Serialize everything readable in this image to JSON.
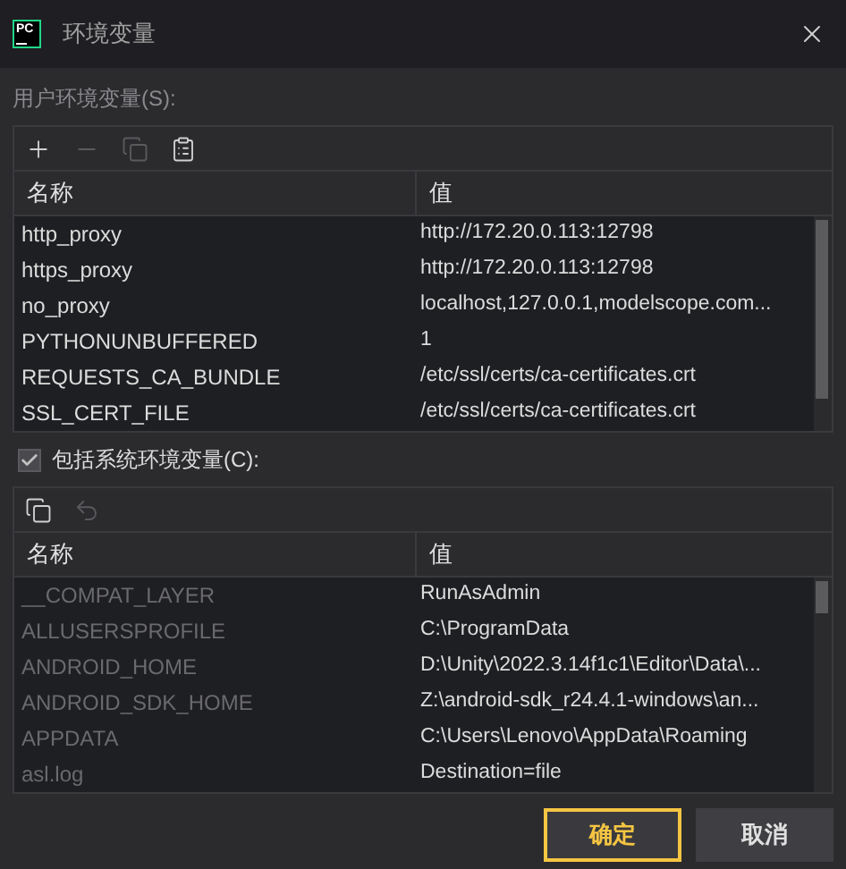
{
  "window": {
    "title": "环境变量",
    "logo_text": "PC"
  },
  "user_vars": {
    "label": "用户环境变量(S):",
    "toolbar": [
      {
        "kind": "add",
        "disabled": false
      },
      {
        "kind": "remove",
        "disabled": true
      },
      {
        "kind": "copy",
        "disabled": true
      },
      {
        "kind": "paste",
        "disabled": false
      }
    ],
    "columns": [
      "名称",
      "值"
    ],
    "rows": [
      {
        "name": "http_proxy",
        "value": "http://172.20.0.113:12798",
        "disabled": false
      },
      {
        "name": "https_proxy",
        "value": "http://172.20.0.113:12798",
        "disabled": false
      },
      {
        "name": "no_proxy",
        "value": "localhost,127.0.0.1,modelscope.com...",
        "disabled": false
      },
      {
        "name": "PYTHONUNBUFFERED",
        "value": "1",
        "disabled": false
      },
      {
        "name": "REQUESTS_CA_BUNDLE",
        "value": "/etc/ssl/certs/ca-certificates.crt",
        "disabled": false
      },
      {
        "name": "SSL_CERT_FILE",
        "value": "/etc/ssl/certs/ca-certificates.crt",
        "disabled": false
      }
    ]
  },
  "include_system": {
    "label": "包括系统环境变量(C):",
    "checked": true
  },
  "system_vars": {
    "toolbar": [
      {
        "kind": "copy",
        "disabled": false
      },
      {
        "kind": "undo",
        "disabled": true
      }
    ],
    "columns": [
      "名称",
      "值"
    ],
    "rows": [
      {
        "name": "__COMPAT_LAYER",
        "value": "RunAsAdmin",
        "disabled": true
      },
      {
        "name": "ALLUSERSPROFILE",
        "value": "C:\\ProgramData",
        "disabled": true
      },
      {
        "name": "ANDROID_HOME",
        "value": "D:\\Unity\\2022.3.14f1c1\\Editor\\Data\\...",
        "disabled": true
      },
      {
        "name": "ANDROID_SDK_HOME",
        "value": "Z:\\android-sdk_r24.4.1-windows\\an...",
        "disabled": true
      },
      {
        "name": "APPDATA",
        "value": "C:\\Users\\Lenovo\\AppData\\Roaming",
        "disabled": true
      },
      {
        "name": "asl.log",
        "value": "Destination=file",
        "disabled": true
      }
    ]
  },
  "buttons": [
    {
      "label": "确定",
      "kind": "primary"
    },
    {
      "label": "取消",
      "kind": "secondary"
    }
  ]
}
